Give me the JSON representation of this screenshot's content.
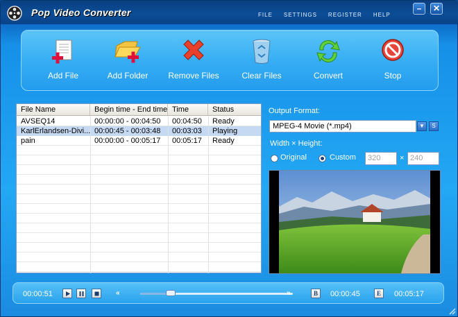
{
  "app": {
    "title": "Pop Video Converter",
    "icon": "film-reel-icon"
  },
  "menu": [
    "FILE",
    "SETTINGS",
    "REGISTER",
    "HELP"
  ],
  "window_controls": {
    "minimize": "–",
    "close": "✕"
  },
  "toolbar": {
    "add_file": "Add File",
    "add_folder": "Add Folder",
    "remove_files": "Remove Files",
    "clear_files": "Clear Files",
    "convert": "Convert",
    "stop": "Stop"
  },
  "file_list": {
    "columns": [
      "File Name",
      "Begin time - End time",
      "Time",
      "Status"
    ],
    "rows": [
      {
        "name": "AVSEQ14",
        "range": "00:00:00 - 00:04:50",
        "time": "00:04:50",
        "status": "Ready",
        "selected": false
      },
      {
        "name": "KarlErlandsen-Divi...",
        "range": "00:00:45 - 00:03:48",
        "time": "00:03:03",
        "status": "Playing",
        "selected": true
      },
      {
        "name": "pain",
        "range": "00:00:00 - 00:05:17",
        "time": "00:05:17",
        "status": "Ready",
        "selected": false
      }
    ]
  },
  "output": {
    "format_label": "Output Format:",
    "format_value": "MPEG-4 Movie (*.mp4)",
    "settings_label": "S",
    "size_label": "Width × Height:",
    "original_label": "Original",
    "custom_label": "Custom",
    "selected_option": "Custom",
    "width": "320",
    "height": "240",
    "times_sign": "×"
  },
  "player": {
    "current_time": "00:00:51",
    "begin_marker": "B",
    "begin_time": "00:00:45",
    "end_marker": "E",
    "end_time": "00:05:17",
    "rewind": "«",
    "forward": "»",
    "position_fraction": 0.2
  },
  "colors": {
    "title_bar": "#0b4d96",
    "panel_blue": "#23a8f4",
    "selection": "#c6d9f3"
  }
}
